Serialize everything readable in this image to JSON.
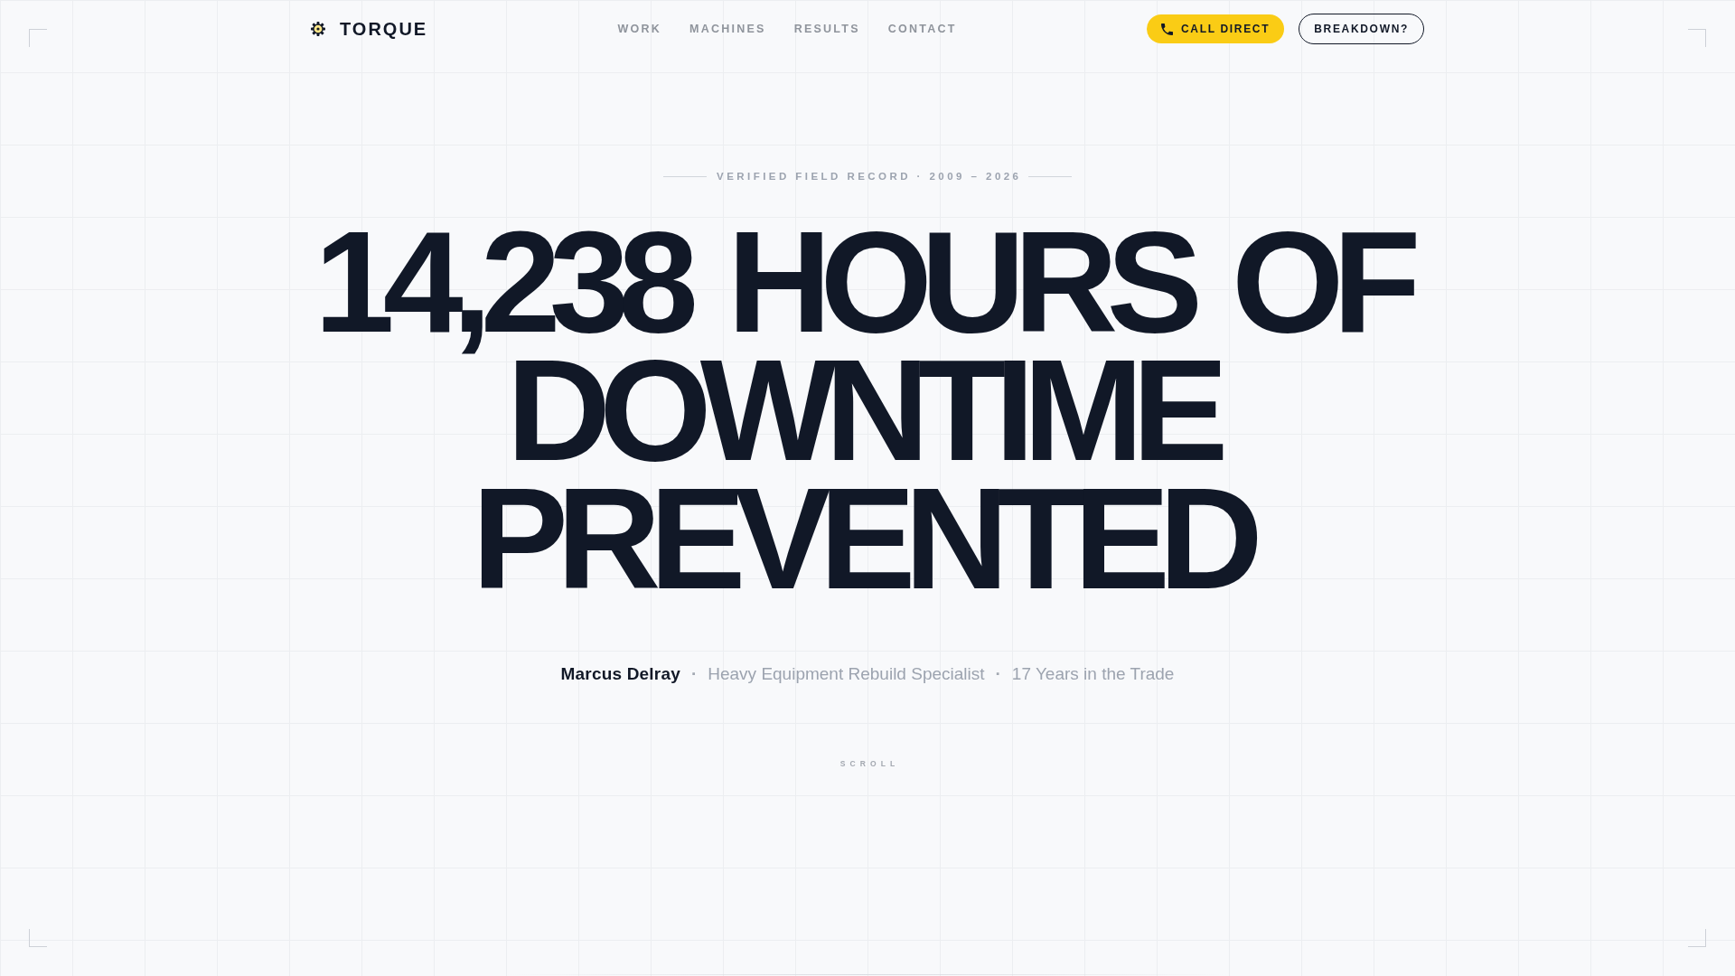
{
  "header": {
    "logo": {
      "name": "TORQUE"
    },
    "nav": [
      {
        "label": "WORK"
      },
      {
        "label": "MACHINES"
      },
      {
        "label": "RESULTS"
      },
      {
        "label": "CONTACT"
      }
    ],
    "actions": [
      {
        "label": "CALL DIRECT",
        "kind": "primary"
      },
      {
        "label": "BREAKDOWN?",
        "kind": "outline"
      }
    ]
  },
  "hero": {
    "eyebrow": "VERIFIED FIELD RECORD · 2009 – 2026",
    "headline": "14,238 HOURS OF DOWNTIME PREVENTED",
    "byline": [
      {
        "kind": "name",
        "text": "Marcus Delray"
      },
      {
        "kind": "separator",
        "text": "·"
      },
      {
        "kind": "detail",
        "text": "Heavy Equipment Rebuild Specialist"
      },
      {
        "kind": "separator",
        "text": "·"
      },
      {
        "kind": "detail",
        "text": "17 Years in the Trade"
      }
    ],
    "scroll_hint": "SCROLL"
  }
}
